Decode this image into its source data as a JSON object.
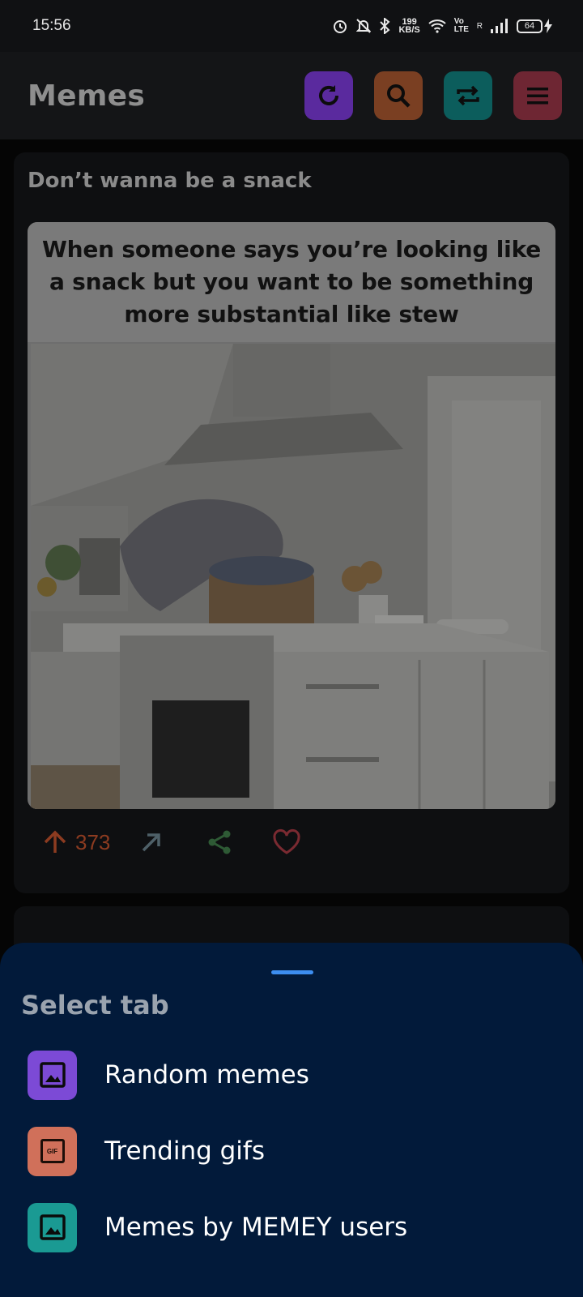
{
  "status_bar": {
    "time": "15:56",
    "net_speed_value": "199",
    "net_speed_unit": "KB/S",
    "network_label": "Vo LTE",
    "sim_label": "R",
    "battery": "64"
  },
  "app_bar": {
    "title": "Memes",
    "refresh_color": "#5a2a9e",
    "search_color": "#7a3f22",
    "switch_color": "#0c5d5c",
    "menu_color": "#6e2633"
  },
  "post": {
    "title": "Don’t wanna be a snack",
    "image_caption": "When someone says you’re looking like a snack but you want to be something more substantial like stew",
    "upvotes": "373"
  },
  "sheet": {
    "title": "Select tab",
    "items": [
      {
        "label": "Random memes",
        "icon": "image-icon",
        "color": "#7c4ad6"
      },
      {
        "label": "Trending gifs",
        "icon": "gif-icon",
        "color": "#d0705a"
      },
      {
        "label": "Memes by MEMEY users",
        "icon": "image-icon",
        "color": "#1a9a93"
      }
    ]
  }
}
